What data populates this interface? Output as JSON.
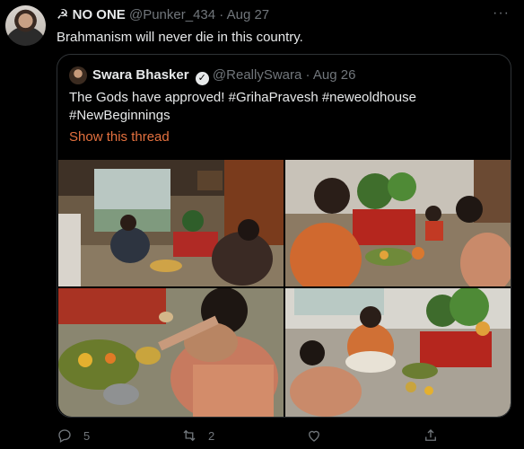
{
  "tweet": {
    "author_name": "☭ NO ONE",
    "author_handle": "@Punker_434",
    "separator": "·",
    "date": "Aug 27",
    "more": "···",
    "text": "Brahmanism will never die in this country."
  },
  "quoted": {
    "author_name": "Swara Bhasker",
    "verified_mark": "✓",
    "author_handle": "@ReallySwara",
    "separator": "·",
    "date": "Aug 26",
    "text": "The Gods have approved! #GrihaPravesh #neweoldhouse #NewBeginnings",
    "show_thread": "Show this thread",
    "accent_color": "#e4713f"
  },
  "actions": {
    "reply_count": "5",
    "retweet_count": "2",
    "like_count": "",
    "share_count": ""
  },
  "icons": [
    "reply-icon",
    "retweet-icon",
    "like-icon",
    "share-icon",
    "more-icon",
    "verified-icon"
  ],
  "theme": {
    "background": "#000000",
    "text": "#e7e9ea",
    "muted": "#71767b",
    "border": "#2f3336"
  }
}
